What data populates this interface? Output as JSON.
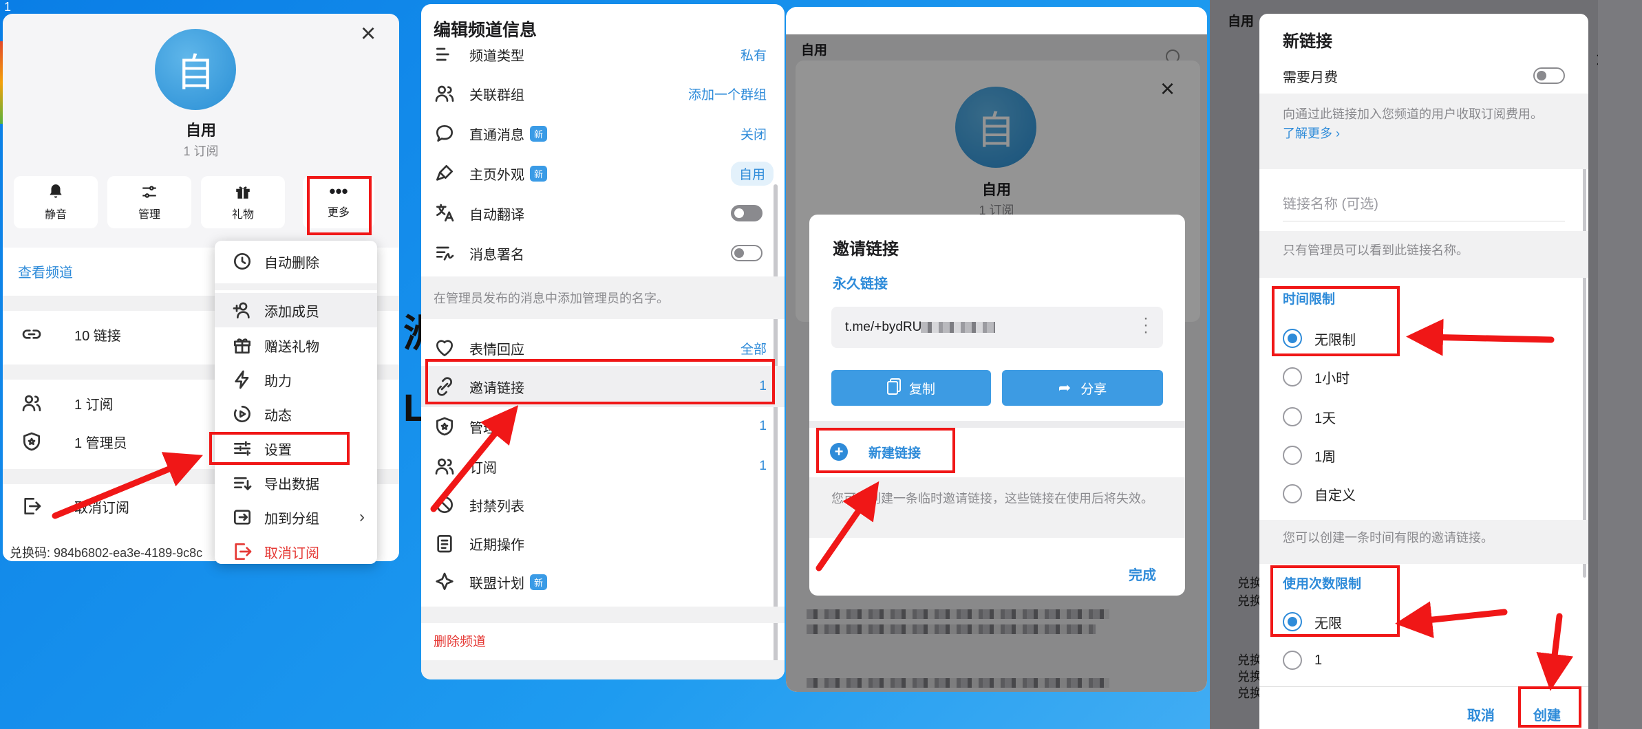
{
  "corner_label": "1",
  "p1": {
    "avatar_char": "自",
    "channel_name": "自用",
    "subs": "1 订阅",
    "actions": [
      {
        "label": "静音",
        "icon": "bell-icon"
      },
      {
        "label": "管理",
        "icon": "sliders-icon"
      },
      {
        "label": "礼物",
        "icon": "gift-icon"
      },
      {
        "label": "更多",
        "icon": "more-icon"
      }
    ],
    "view_channel": "查看频道",
    "links": "10 链接",
    "subscribers": "1 订阅",
    "admins": "1 管理员",
    "unsubscribe_partial": "取消订阅",
    "redeem": "兑换码: 984b6802-ea3e-4189-9c8c",
    "menu": [
      {
        "label": "自动删除",
        "icon": "timer-icon"
      },
      {
        "label": "添加成员",
        "icon": "add-user-icon"
      },
      {
        "label": "赠送礼物",
        "icon": "gift-icon"
      },
      {
        "label": "助力",
        "icon": "bolt-icon"
      },
      {
        "label": "动态",
        "icon": "story-icon"
      },
      {
        "label": "设置",
        "icon": "settings-icon"
      },
      {
        "label": "导出数据",
        "icon": "export-icon"
      },
      {
        "label": "加到分组",
        "icon": "folder-icon"
      },
      {
        "label": "取消订阅",
        "icon": "leave-icon"
      }
    ]
  },
  "p2": {
    "title": "编辑频道信息",
    "channel_type": {
      "label": "频道类型",
      "value": "私有"
    },
    "linked_group": {
      "label": "关联群组",
      "value": "添加一个群组"
    },
    "direct_msg": {
      "label": "直通消息",
      "tag": "新",
      "value": "关闭"
    },
    "appearance": {
      "label": "主页外观",
      "tag": "新",
      "value": "自用"
    },
    "auto_translate": {
      "label": "自动翻译"
    },
    "sign_msgs": {
      "label": "消息署名"
    },
    "sign_hint": "在管理员发布的消息中添加管理员的名字。",
    "reactions": {
      "label": "表情回应",
      "value": "全部"
    },
    "invite_links": {
      "label": "邀请链接",
      "value": "1"
    },
    "admins": {
      "label": "管理员",
      "value": "1"
    },
    "subscribers": {
      "label": "订阅",
      "value": "1"
    },
    "banned": {
      "label": "封禁列表"
    },
    "recent": {
      "label": "近期操作"
    },
    "affiliate": {
      "label": "联盟计划",
      "tag": "新"
    },
    "delete": "删除频道"
  },
  "p3": {
    "top_label": "自用",
    "avatar_char": "自",
    "name": "自用",
    "subs": "1 订阅",
    "dialog_title": "邀请链接",
    "permanent": "永久链接",
    "link": "t.me/+bydRU",
    "copy": "复制",
    "share": "分享",
    "new_link": "新建链接",
    "hint": "您可以创建一条临时邀请链接，这些链接在使用后将失效。",
    "done": "完成"
  },
  "p4": {
    "behind_label": "自用",
    "title": "新链接",
    "monthly_fee": "需要月费",
    "fee_hint": "向通过此链接加入您频道的用户收取订阅费用。",
    "learn_more": "了解更多 ›",
    "name_placeholder": "链接名称 (可选)",
    "name_hint": "只有管理员可以看到此链接名称。",
    "time_section": "时间限制",
    "time_options": [
      "无限制",
      "1小时",
      "1天",
      "1周",
      "自定义"
    ],
    "time_hint": "您可以创建一条时间有限的邀请链接。",
    "uses_section": "使用次数限制",
    "uses_options": [
      "无限",
      "1"
    ],
    "cancel": "取消",
    "create": "创建",
    "behind_texts": [
      "兑换码",
      "兑换码",
      "兑换码",
      "兑换码",
      "兑换码"
    ]
  }
}
